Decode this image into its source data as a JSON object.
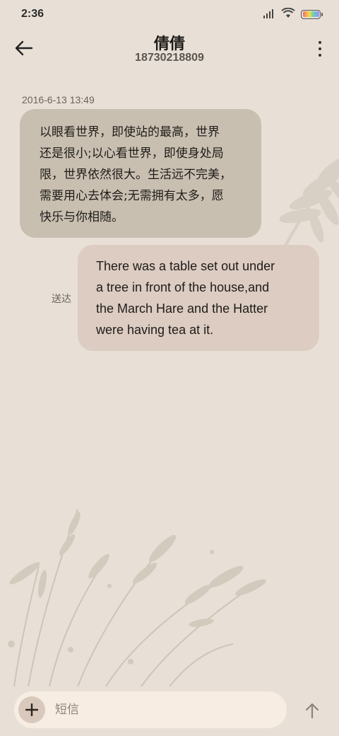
{
  "status_bar": {
    "time": "2:36",
    "icons": [
      "signal-icon",
      "wifi-icon",
      "battery-icon"
    ]
  },
  "header": {
    "contact_name": "倩倩",
    "contact_number": "18730218809",
    "back_icon": "back-arrow-icon",
    "more_icon": "more-vertical-icon"
  },
  "conversation": {
    "timestamp": "2016-6-13 13:49",
    "messages": [
      {
        "direction": "incoming",
        "lines": [
          "以眼看世界，即使站的最高，世界",
          "还是很小;以心看世界，即使身处局",
          "限，世界依然很大。生活远不完美，",
          "需要用心去体会;无需拥有太多，愿",
          "快乐与你相随。"
        ]
      },
      {
        "direction": "outgoing",
        "status": "送达",
        "lines": [
          "There was a table set out under",
          "a tree in front of the house,and",
          "the March Hare and the Hatter",
          "were having tea at it."
        ]
      }
    ]
  },
  "composer": {
    "placeholder": "短信",
    "add_icon": "plus-icon",
    "send_icon": "send-arrow-up-icon"
  },
  "colors": {
    "background": "#e8e0d6",
    "incoming_bubble": "#c9bfb0",
    "outgoing_bubble": "#dcccc2",
    "composer": "#f7ede2"
  }
}
